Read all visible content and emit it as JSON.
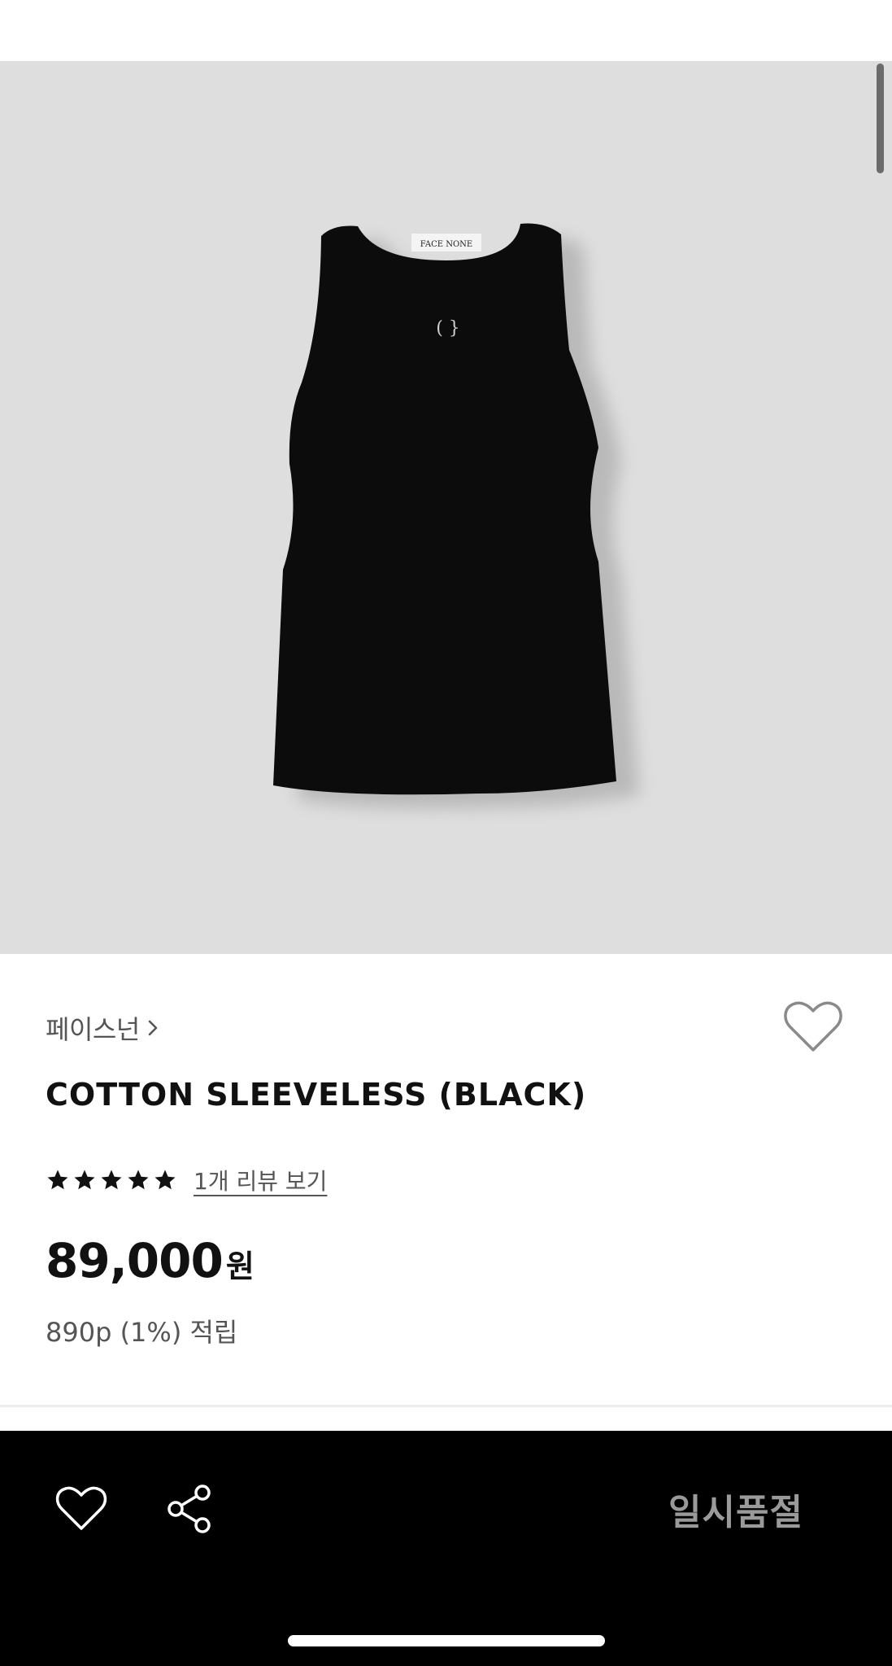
{
  "product": {
    "brand_label": "페이스넌",
    "title": "COTTON SLEEVELESS (BLACK)",
    "image_label_text": "FACE NONE",
    "image_emblem_text": "( }",
    "rating": {
      "stars": 5,
      "max": 5
    },
    "review_link_label": "1개 리뷰 보기",
    "price": "89,000",
    "price_unit": "원",
    "points_text": "890p (1%) 적립"
  },
  "bottom_bar": {
    "status_label": "일시품절"
  },
  "icons": {
    "brand_chevron": "chevron-right-icon",
    "wishlist": "heart-outline-icon",
    "share": "share-icon",
    "rating": "star-icon"
  },
  "colors": {
    "hero_background": "#dedede",
    "bottom_bar_background": "#000000",
    "soldout_text": "#9a9a9a",
    "secondary_text": "#555555"
  }
}
